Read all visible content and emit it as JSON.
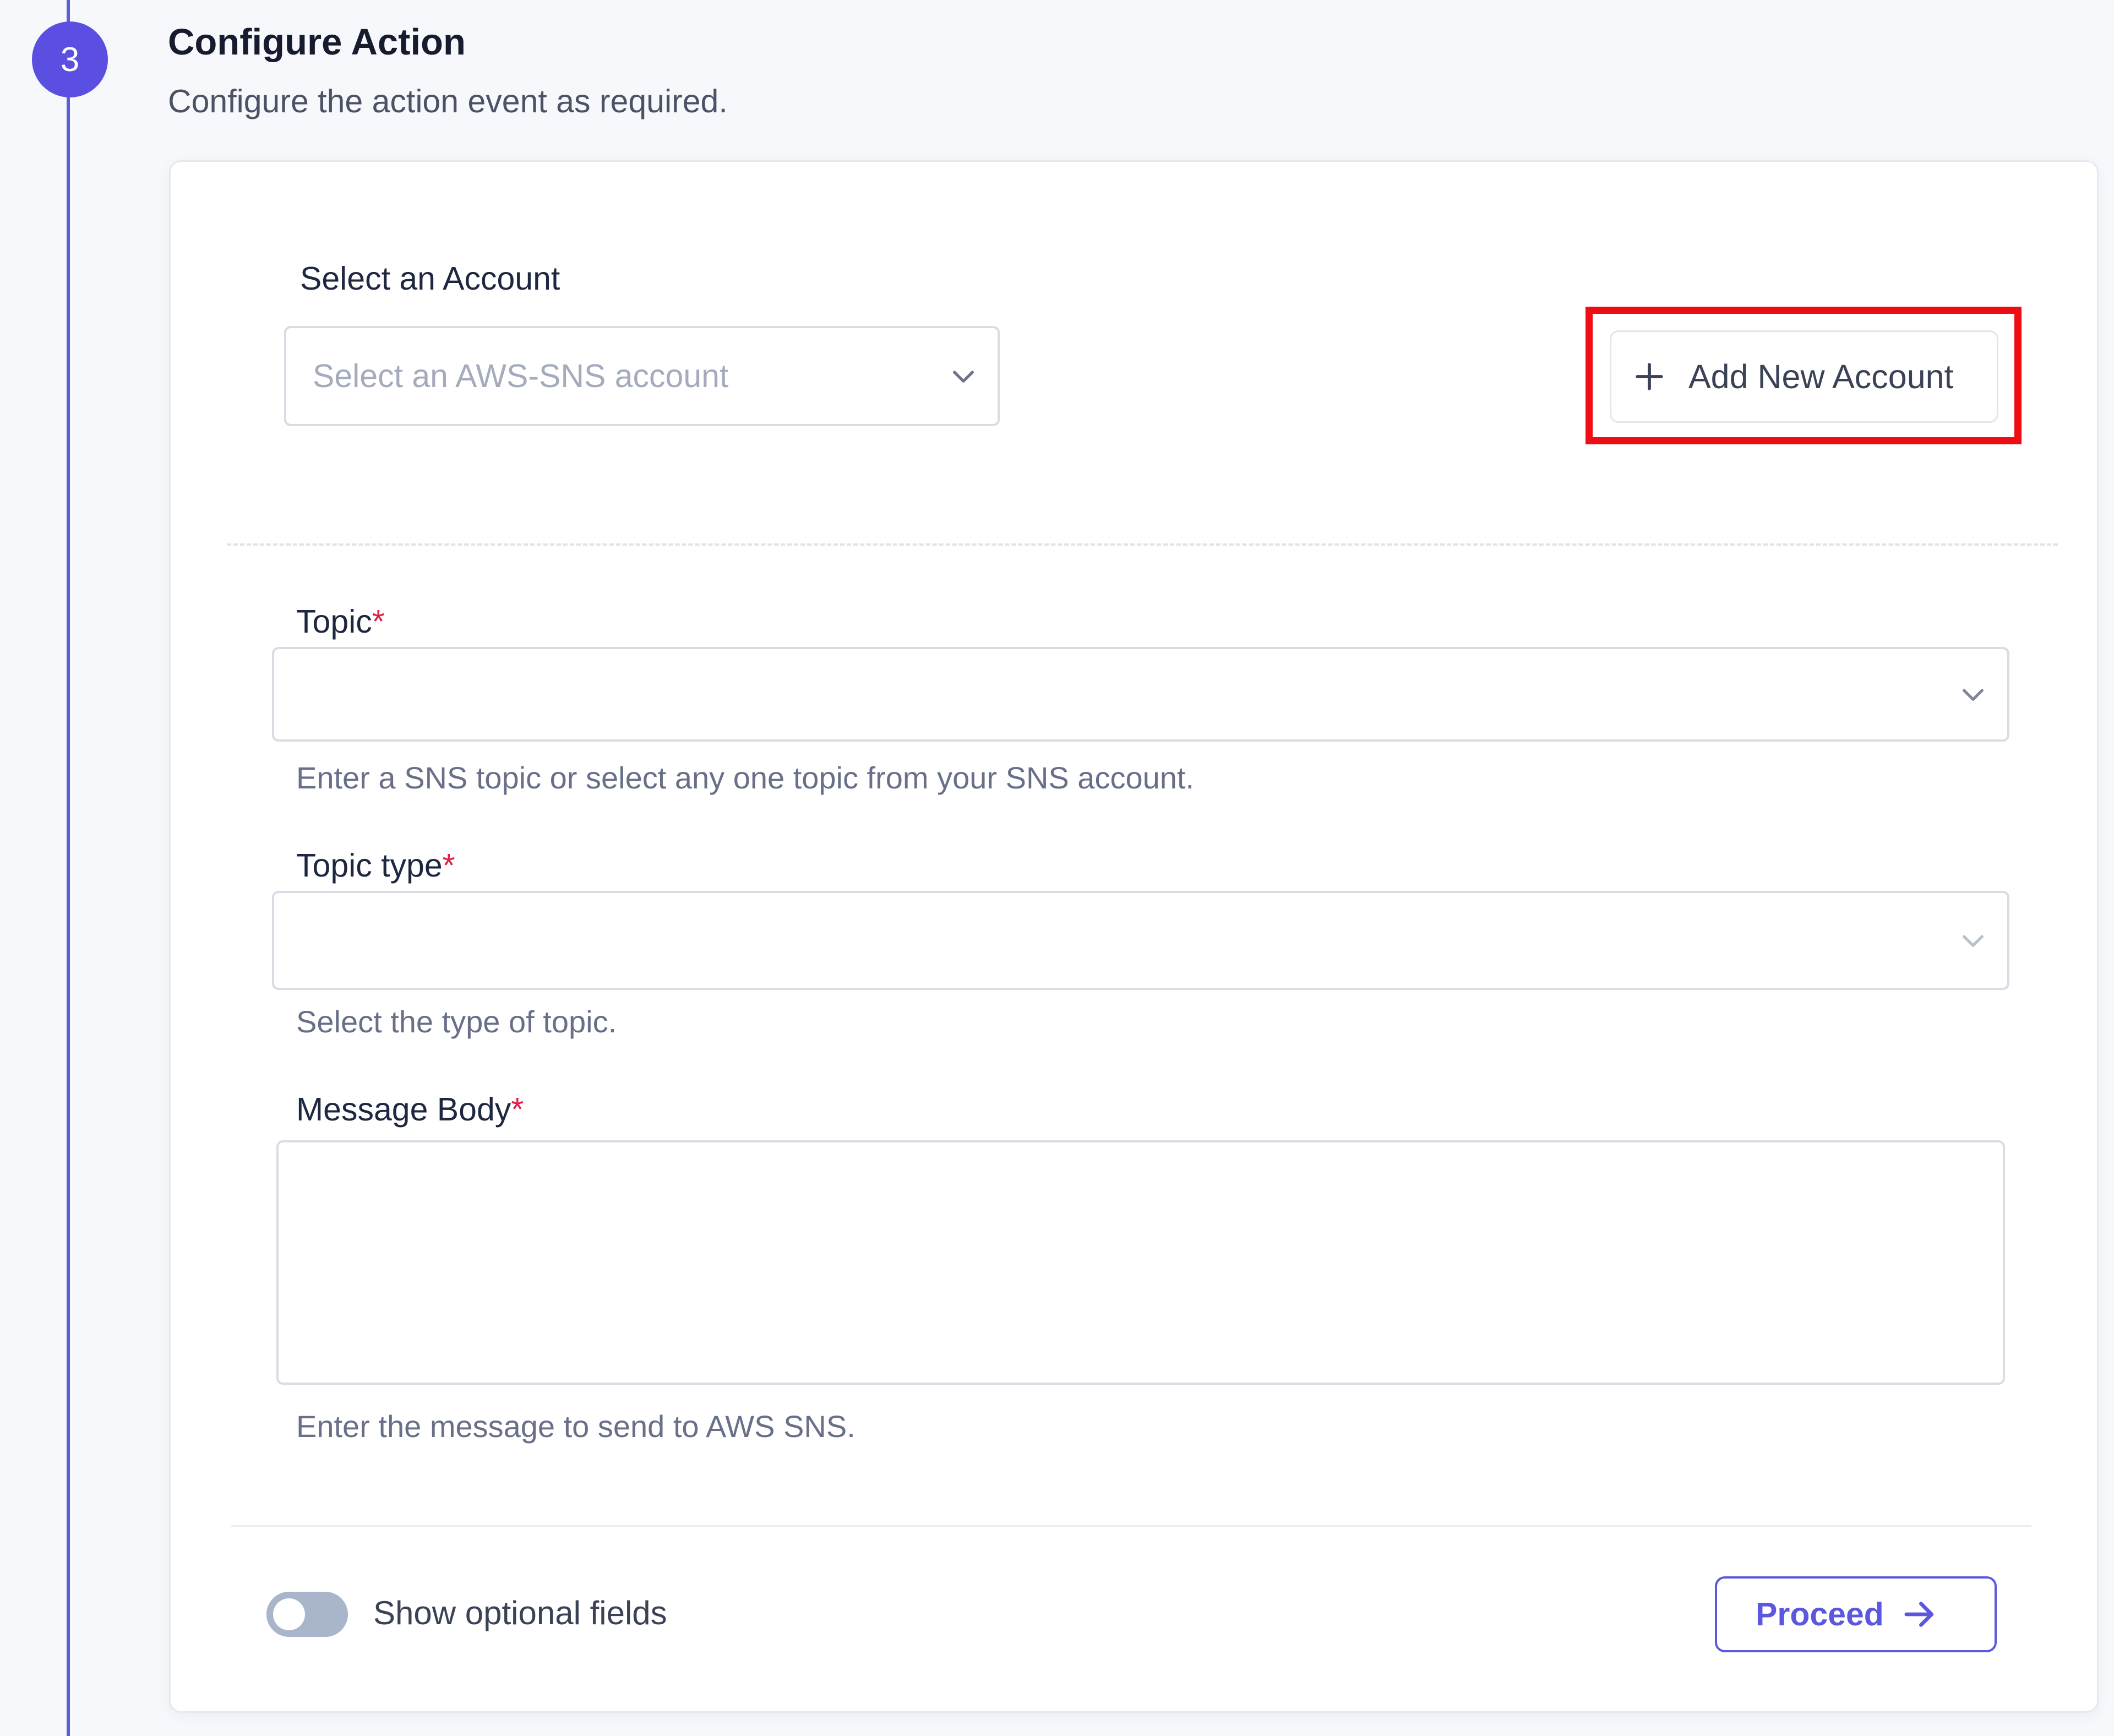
{
  "step": {
    "number": "3",
    "title": "Configure Action",
    "subtitle": "Configure the action event as required."
  },
  "account": {
    "label": "Select an Account",
    "placeholder": "Select an AWS-SNS account",
    "add_button_label": "Add New Account"
  },
  "fields": {
    "topic": {
      "label": "Topic",
      "required_mark": "*",
      "value": "",
      "helper": "Enter a SNS topic or select any one topic from your SNS account."
    },
    "topic_type": {
      "label": "Topic type",
      "required_mark": "*",
      "value": "",
      "helper": "Select the type of topic."
    },
    "message_body": {
      "label": "Message Body",
      "required_mark": "*",
      "value": "",
      "helper": "Enter the message to send to AWS SNS."
    }
  },
  "footer": {
    "toggle_label": "Show optional fields",
    "toggle_on": false,
    "proceed_label": "Proceed"
  },
  "icons": {
    "dropdown": "chevron-down-icon",
    "add": "plus-icon",
    "proceed": "arrow-right-icon"
  },
  "colors": {
    "accent": "#5b57e0",
    "step_circle": "#5a4fe0",
    "required": "#e01e47",
    "highlight_box": "#ee0d12",
    "toggle_off": "#a9b5ca"
  }
}
